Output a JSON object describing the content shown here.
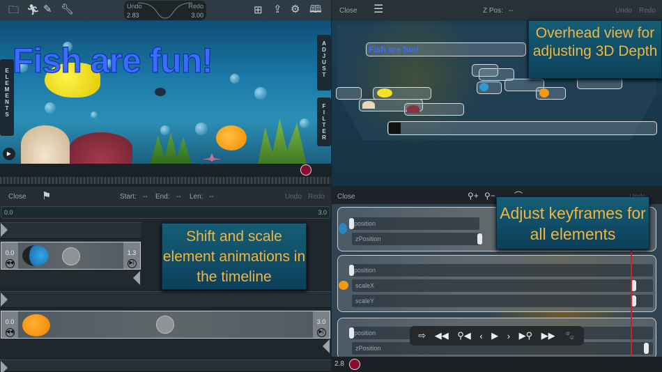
{
  "editor": {
    "undo_label": "Undo",
    "undo_value": "2.83",
    "redo_label": "Redo",
    "redo_value": "3.00",
    "title_text": "Fish are fun!",
    "side_tabs": {
      "elements": "ELEMENTS",
      "adjust": "ADJUST",
      "filter": "FILTER"
    },
    "icons": [
      "folder-icon",
      "run-icon",
      "pencil-icon",
      "wrench-icon",
      "hierarchy-icon",
      "share-icon",
      "gear-icon",
      "book-icon",
      "play-icon",
      "record-icon"
    ]
  },
  "overhead": {
    "close_label": "Close",
    "zpos_label": "Z Pos:",
    "zpos_value": "--",
    "undo_label": "Undo",
    "redo_label": "Redo",
    "title_element": "Fish are fun!",
    "callout": "Overhead view for adjusting 3D Depth"
  },
  "timeline": {
    "close_label": "Close",
    "start_label": "Start:",
    "start_value": "--",
    "end_label": "End:",
    "end_value": "--",
    "len_label": "Len:",
    "len_value": "--",
    "undo_label": "Undo",
    "redo_label": "Redo",
    "ruler_start": "0.0",
    "ruler_end": "3.0",
    "clips": [
      {
        "start": "0.0",
        "end": "1.3"
      },
      {
        "start": "0.0",
        "end": "3.0"
      }
    ],
    "callout": "Shift and scale element animations in the timeline"
  },
  "keyframes": {
    "close_label": "Close",
    "undo_label": "Undo",
    "callout": "Adjust keyframes for all elements",
    "groups": [
      {
        "tracks": [
          "position",
          "zPosition"
        ]
      },
      {
        "tracks": [
          "position",
          "scaleX",
          "scaleY"
        ]
      },
      {
        "tracks": [
          "position",
          "zPosition"
        ]
      }
    ],
    "current_time": "2.8",
    "playhead_fraction": 0.93,
    "record_color": "#8a0a2e"
  }
}
